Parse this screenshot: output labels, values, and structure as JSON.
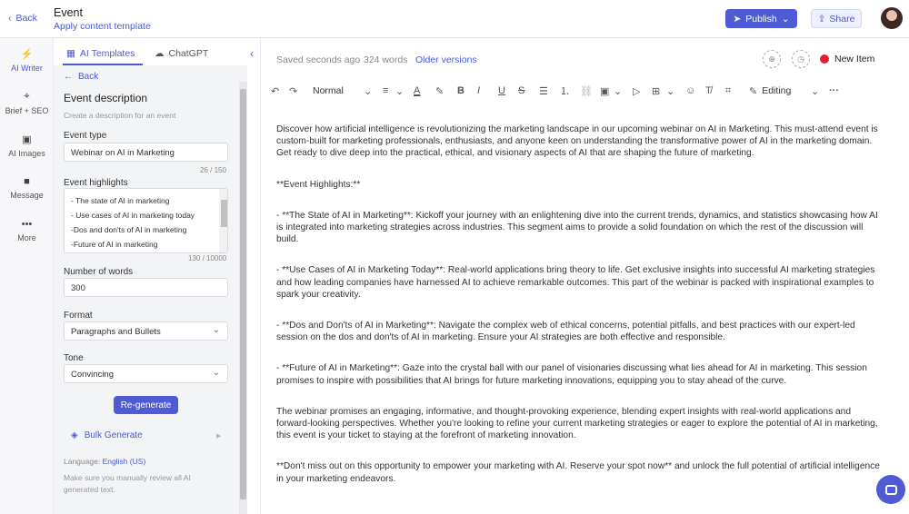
{
  "header": {
    "back_label": "Back",
    "title": "Event",
    "subtitle": "Apply content template",
    "publish_label": "Publish",
    "share_label": "Share"
  },
  "rail": {
    "items": [
      {
        "label": "AI Writer",
        "icon": "lightning-icon"
      },
      {
        "label": "Brief + SEO",
        "icon": "target-icon"
      },
      {
        "label": "AI Images",
        "icon": "image-icon"
      },
      {
        "label": "Message",
        "icon": "message-icon"
      },
      {
        "label": "More",
        "icon": "more-icon"
      }
    ]
  },
  "panel": {
    "tabs": [
      {
        "label": "AI Templates",
        "icon": "template-icon"
      },
      {
        "label": "ChatGPT",
        "icon": "chat-icon"
      }
    ],
    "back_label": "Back",
    "title": "Event description",
    "description": "Create a description for an event",
    "event_type": {
      "label": "Event type",
      "value": "Webinar on AI in Marketing",
      "count": "26 / 150"
    },
    "event_highlights": {
      "label": "Event highlights",
      "lines": [
        " - The state of AI in marketing",
        " - Use cases of AI in marketing today",
        " -Dos and don'ts of AI in marketing",
        " -Future of AI in marketing"
      ],
      "count": "130 / 10000"
    },
    "words": {
      "label": "Number of words",
      "value": "300"
    },
    "format": {
      "label": "Format",
      "value": "Paragraphs and Bullets"
    },
    "tone": {
      "label": "Tone",
      "value": "Convincing"
    },
    "regenerate_label": "Re-generate",
    "bulk_label": "Bulk Generate",
    "language_prefix": "Language:",
    "language_value": "English (US)",
    "note": "Make sure you manually review all AI generated text."
  },
  "editor": {
    "saved": "Saved seconds ago",
    "words": "324 words",
    "older_versions": "Older versions",
    "new_item": "New Item",
    "status_color": "#e0202e",
    "style_value": "Normal",
    "mode_value": "Editing",
    "paragraphs": [
      "Discover how artificial intelligence is revolutionizing the marketing landscape in our upcoming webinar on AI in Marketing. This must-attend event is custom-built for marketing professionals, enthusiasts, and anyone keen on understanding the transformative power of AI in the marketing domain. Get ready to dive deep into the practical, ethical, and visionary aspects of AI that are shaping the future of marketing.",
      "**Event Highlights:**",
      "- **The State of AI in Marketing**: Kickoff your journey with an enlightening dive into the current trends, dynamics, and statistics showcasing how AI is integrated into marketing strategies across industries. This segment aims to provide a solid foundation on which the rest of the discussion will build.",
      "- **Use Cases of AI in Marketing Today**: Real-world applications bring theory to life. Get exclusive insights into successful AI marketing strategies and how leading companies have harnessed AI to achieve remarkable outcomes. This part of the webinar is packed with inspirational examples to spark your creativity.",
      "- **Dos and Don'ts of AI in Marketing**: Navigate the complex web of ethical concerns, potential pitfalls, and best practices with our expert-led session on the dos and don'ts of AI in marketing. Ensure your AI strategies are both effective and responsible.",
      "- **Future of AI in Marketing**: Gaze into the crystal ball with our panel of visionaries discussing what lies ahead for AI in marketing. This session promises to inspire with possibilities that AI brings for future marketing innovations, equipping you to stay ahead of the curve.",
      "The webinar promises an engaging, informative, and thought-provoking experience, blending expert insights with real-world applications and forward-looking perspectives. Whether you're looking to refine your current marketing strategies or eager to explore the potential of AI in marketing, this event is your ticket to staying at the forefront of marketing innovation.",
      "**Don't miss out on this opportunity to empower your marketing with AI. Reserve your spot now** and unlock the full potential of artificial intelligence in your marketing endeavors."
    ]
  },
  "colors": {
    "accent": "#4f5bd5",
    "link": "#4a5bd4"
  }
}
